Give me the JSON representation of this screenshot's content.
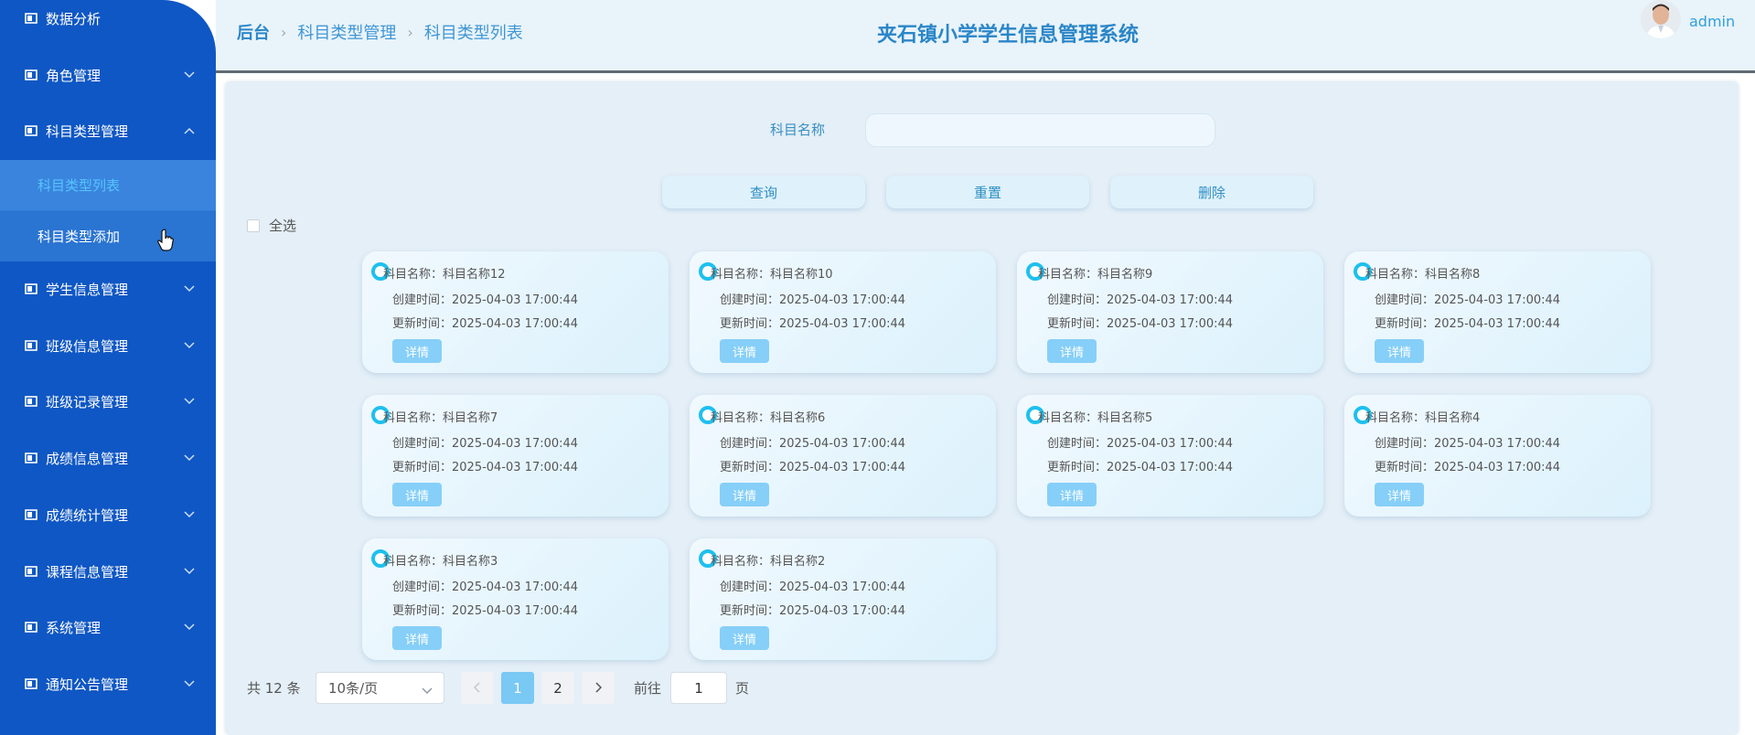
{
  "sidebar": {
    "items": [
      {
        "label": "数据分析"
      },
      {
        "label": "角色管理"
      },
      {
        "label": "科目类型管理"
      },
      {
        "label": "学生信息管理"
      },
      {
        "label": "班级信息管理"
      },
      {
        "label": "班级记录管理"
      },
      {
        "label": "成绩信息管理"
      },
      {
        "label": "成绩统计管理"
      },
      {
        "label": "课程信息管理"
      },
      {
        "label": "系统管理"
      },
      {
        "label": "通知公告管理"
      }
    ],
    "submenu": [
      {
        "label": "科目类型列表"
      },
      {
        "label": "科目类型添加"
      }
    ]
  },
  "header": {
    "breadcrumb": [
      "后台",
      "科目类型管理",
      "科目类型列表"
    ],
    "title": "夹石镇小学学生信息管理系统",
    "user": "admin"
  },
  "search": {
    "label": "科目名称",
    "value": ""
  },
  "actions": {
    "query": "查询",
    "reset": "重置",
    "delete": "删除"
  },
  "select_all": "全选",
  "cards": [
    {
      "name": "科目名称：科目名称12",
      "created": "创建时间：2025-04-03 17:00:44",
      "updated": "更新时间：2025-04-03 17:00:44",
      "detail": "详情"
    },
    {
      "name": "科目名称：科目名称10",
      "created": "创建时间：2025-04-03 17:00:44",
      "updated": "更新时间：2025-04-03 17:00:44",
      "detail": "详情"
    },
    {
      "name": "科目名称：科目名称9",
      "created": "创建时间：2025-04-03 17:00:44",
      "updated": "更新时间：2025-04-03 17:00:44",
      "detail": "详情"
    },
    {
      "name": "科目名称：科目名称8",
      "created": "创建时间：2025-04-03 17:00:44",
      "updated": "更新时间：2025-04-03 17:00:44",
      "detail": "详情"
    },
    {
      "name": "科目名称：科目名称7",
      "created": "创建时间：2025-04-03 17:00:44",
      "updated": "更新时间：2025-04-03 17:00:44",
      "detail": "详情"
    },
    {
      "name": "科目名称：科目名称6",
      "created": "创建时间：2025-04-03 17:00:44",
      "updated": "更新时间：2025-04-03 17:00:44",
      "detail": "详情"
    },
    {
      "name": "科目名称：科目名称5",
      "created": "创建时间：2025-04-03 17:00:44",
      "updated": "更新时间：2025-04-03 17:00:44",
      "detail": "详情"
    },
    {
      "name": "科目名称：科目名称4",
      "created": "创建时间：2025-04-03 17:00:44",
      "updated": "更新时间：2025-04-03 17:00:44",
      "detail": "详情"
    },
    {
      "name": "科目名称：科目名称3",
      "created": "创建时间：2025-04-03 17:00:44",
      "updated": "更新时间：2025-04-03 17:00:44",
      "detail": "详情"
    },
    {
      "name": "科目名称：科目名称2",
      "created": "创建时间：2025-04-03 17:00:44",
      "updated": "更新时间：2025-04-03 17:00:44",
      "detail": "详情"
    }
  ],
  "pagination": {
    "total": "共 12 条",
    "page_size": "10条/页",
    "pages": [
      "1",
      "2"
    ],
    "current": "1",
    "goto_label": "前往",
    "goto_value": "1",
    "goto_suffix": "页"
  },
  "colors": {
    "sidebar_bg": "#0f57c4",
    "accent": "#2a86c8",
    "active_page": "#7ac8f4",
    "card_radio": "#1ec0ee"
  }
}
